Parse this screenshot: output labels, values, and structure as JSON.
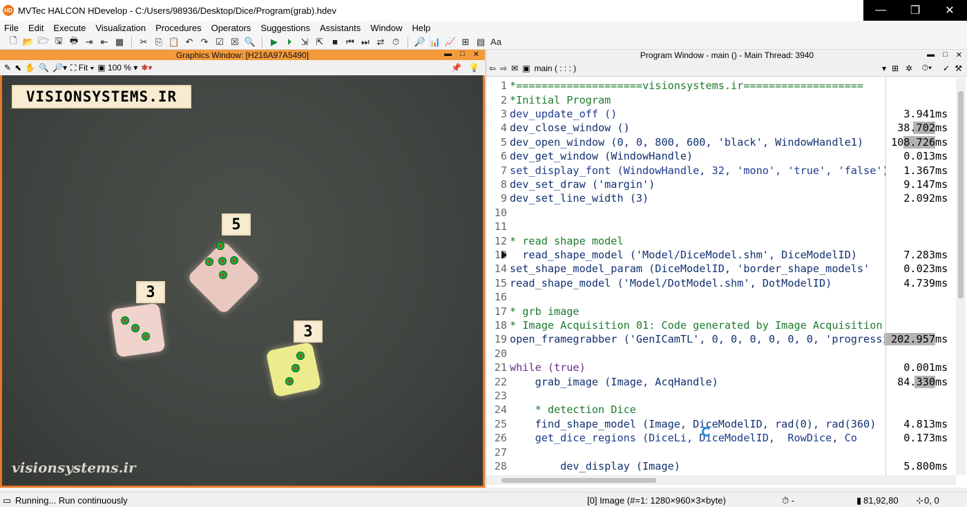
{
  "window": {
    "app_icon": "HD",
    "title": "MVTec HALCON HDevelop - C:/Users/98936/Desktop/Dice/Program(grab).hdev",
    "minimize": "—",
    "restore": "❐",
    "close": "✕"
  },
  "menu": [
    "File",
    "Edit",
    "Execute",
    "Visualization",
    "Procedures",
    "Operators",
    "Suggestions",
    "Assistants",
    "Window",
    "Help"
  ],
  "graphics_window": {
    "title": "Graphics Window: [H216A97A5490]",
    "fit_label": "Fit",
    "zoom_label": "100 %",
    "banner": "VISIONSYSTEMS.IR",
    "watermark": "visionsystems.ir",
    "dice": [
      {
        "label": "5",
        "color": "#e9c8c0"
      },
      {
        "label": "3",
        "color": "#efd3cc"
      },
      {
        "label": "3",
        "color": "#ecec8e"
      }
    ]
  },
  "program_window": {
    "title": "Program Window - main () - Main Thread: 3940",
    "procedure": "main ( : : : )",
    "unit": "ms",
    "lines": [
      {
        "n": "1",
        "code": "*====================visionsystems.ir===================",
        "kind": "comment",
        "time": ""
      },
      {
        "n": "2",
        "code": "*Initial Program",
        "kind": "comment",
        "time": ""
      },
      {
        "n": "3",
        "code": "dev_update_off ()",
        "kind": "op",
        "time": "3.941"
      },
      {
        "n": "4",
        "code": "dev_close_window ()",
        "kind": "plain",
        "time": "38.702"
      },
      {
        "n": "5",
        "code": "dev_open_window (0, 0, 800, 600, 'black', WindowHandle1)",
        "kind": "plain",
        "time": "108.726"
      },
      {
        "n": "6",
        "code": "dev_get_window (WindowHandle)",
        "kind": "plain",
        "time": "0.013"
      },
      {
        "n": "7",
        "code": "set_display_font (WindowHandle, 32, 'mono', 'true', 'false')",
        "kind": "op",
        "time": "1.367"
      },
      {
        "n": "8",
        "code": "dev_set_draw ('margin')",
        "kind": "plain",
        "time": "9.147"
      },
      {
        "n": "9",
        "code": "dev_set_line_width (3)",
        "kind": "plain",
        "time": "2.092"
      },
      {
        "n": "10",
        "code": "",
        "kind": "plain",
        "time": ""
      },
      {
        "n": "11",
        "code": "",
        "kind": "plain",
        "time": ""
      },
      {
        "n": "12",
        "code": "* read shape model",
        "kind": "comment",
        "time": ""
      },
      {
        "n": "13",
        "code": "  read_shape_model ('Model/DiceModel.shm', DiceModelID)",
        "kind": "plain",
        "time": "7.283"
      },
      {
        "n": "14",
        "code": "set_shape_model_param (DiceModelID, 'border_shape_models'",
        "kind": "plain",
        "time": "0.023"
      },
      {
        "n": "15",
        "code": "read_shape_model ('Model/DotModel.shm', DotModelID)",
        "kind": "plain",
        "time": "4.739"
      },
      {
        "n": "16",
        "code": "",
        "kind": "plain",
        "time": ""
      },
      {
        "n": "17",
        "code": "* grb image",
        "kind": "comment",
        "time": ""
      },
      {
        "n": "18",
        "code": "* Image Acquisition 01: Code generated by Image Acquisition",
        "kind": "comment",
        "time": ""
      },
      {
        "n": "19",
        "code": "open_framegrabber ('GenICamTL', 0, 0, 0, 0, 0, 0, 'progressive'",
        "kind": "plain",
        "time": "202.957"
      },
      {
        "n": "20",
        "code": "",
        "kind": "plain",
        "time": ""
      },
      {
        "n": "21",
        "code": "while (true)",
        "kind": "ctrl",
        "time": "0.001"
      },
      {
        "n": "22",
        "code": "    grab_image (Image, AcqHandle)",
        "kind": "plain",
        "time": "84.330"
      },
      {
        "n": "23",
        "code": "",
        "kind": "plain",
        "time": ""
      },
      {
        "n": "24",
        "code": "    * detection Dice",
        "kind": "comment",
        "time": ""
      },
      {
        "n": "25",
        "code": "    find_shape_model (Image, DiceModelID, rad(0), rad(360)",
        "kind": "plain",
        "time": "4.813"
      },
      {
        "n": "26",
        "code": "    get_dice_regions (DiceLi, DiceModelID,  RowDice, Co",
        "kind": "op",
        "time": "0.173"
      },
      {
        "n": "27",
        "code": "",
        "kind": "plain",
        "time": ""
      },
      {
        "n": "28",
        "code": "        dev_display (Image)",
        "kind": "plain",
        "time": "5.800"
      }
    ]
  },
  "status": {
    "running": "Running... Run continuously",
    "image_info": "[0] Image (#=1: 1280×960×3×byte)",
    "time_info": "⏱ -",
    "pixel_value": "81,92,80",
    "coords": "0, 0"
  }
}
